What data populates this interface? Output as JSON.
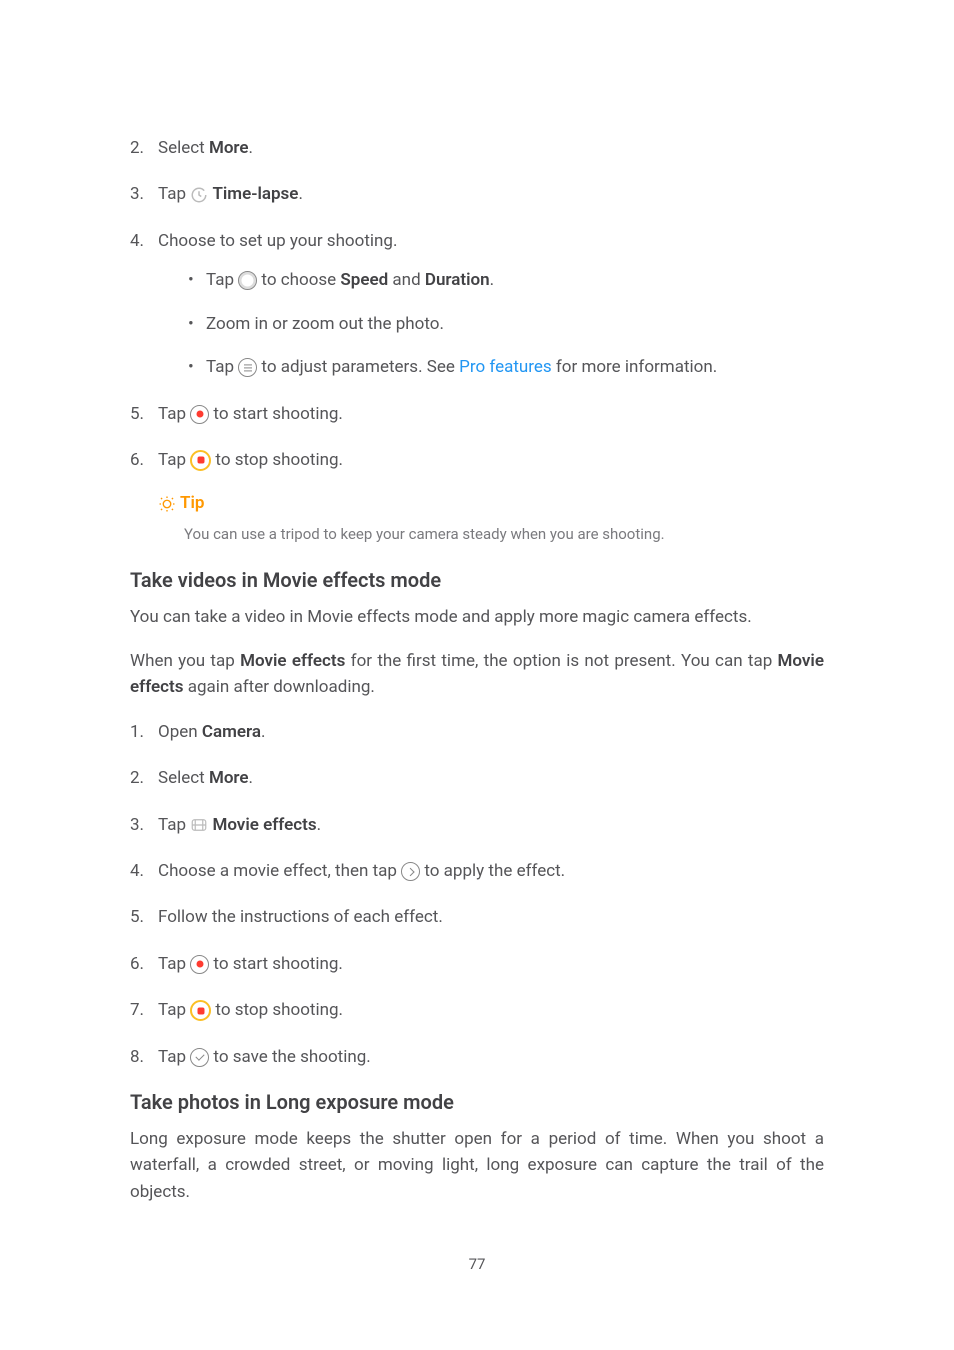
{
  "list1": {
    "i2": {
      "num": "2.",
      "t1": "Select ",
      "bold": "More",
      "t2": "."
    },
    "i3": {
      "num": "3.",
      "t1": "Tap ",
      "bold": "Time-lapse",
      "t2": "."
    },
    "i4": {
      "num": "4.",
      "t1": "Choose to set up your shooting."
    },
    "i4b1": {
      "t1": "Tap ",
      "t2": " to choose ",
      "b1": "Speed",
      "t3": " and ",
      "b2": "Duration",
      "t4": "."
    },
    "i4b2": {
      "t1": "Zoom in or zoom out the photo."
    },
    "i4b3": {
      "t1": "Tap ",
      "t2": " to adjust parameters. See ",
      "link": "Pro features",
      "t3": " for more information."
    },
    "i5": {
      "num": "5.",
      "t1": "Tap ",
      "t2": " to start shooting."
    },
    "i6": {
      "num": "6.",
      "t1": "Tap ",
      "t2": " to stop shooting."
    }
  },
  "tip": {
    "label": "Tip",
    "text": "You can use a tripod to keep your camera steady when you are shooting."
  },
  "h1": "Take videos in Movie effects mode",
  "p1": "You can take a video in Movie effects mode and apply more magic camera effects.",
  "p2": {
    "t1": "When you tap ",
    "b1": "Movie effects",
    "t2": " for the first time, the option is not present. You can tap ",
    "b2": "Movie effects",
    "t3": " again after downloading."
  },
  "list2": {
    "i1": {
      "num": "1.",
      "t1": "Open ",
      "bold": "Camera",
      "t2": "."
    },
    "i2": {
      "num": "2.",
      "t1": "Select ",
      "bold": "More",
      "t2": "."
    },
    "i3": {
      "num": "3.",
      "t1": "Tap ",
      "bold": "Movie effects",
      "t2": "."
    },
    "i4": {
      "num": "4.",
      "t1": "Choose a movie effect, then tap ",
      "t2": " to apply the effect."
    },
    "i5": {
      "num": "5.",
      "t1": "Follow the instructions of each effect."
    },
    "i6": {
      "num": "6.",
      "t1": "Tap ",
      "t2": " to start shooting."
    },
    "i7": {
      "num": "7.",
      "t1": "Tap ",
      "t2": " to stop shooting."
    },
    "i8": {
      "num": "8.",
      "t1": "Tap ",
      "t2": " to save the shooting."
    }
  },
  "h2": "Take photos in Long exposure mode",
  "p3": "Long exposure mode keeps the shutter open for a period of time. When you shoot a waterfall, a crowded street, or moving light, long exposure can capture the trail of the objects.",
  "pagenum": "77"
}
